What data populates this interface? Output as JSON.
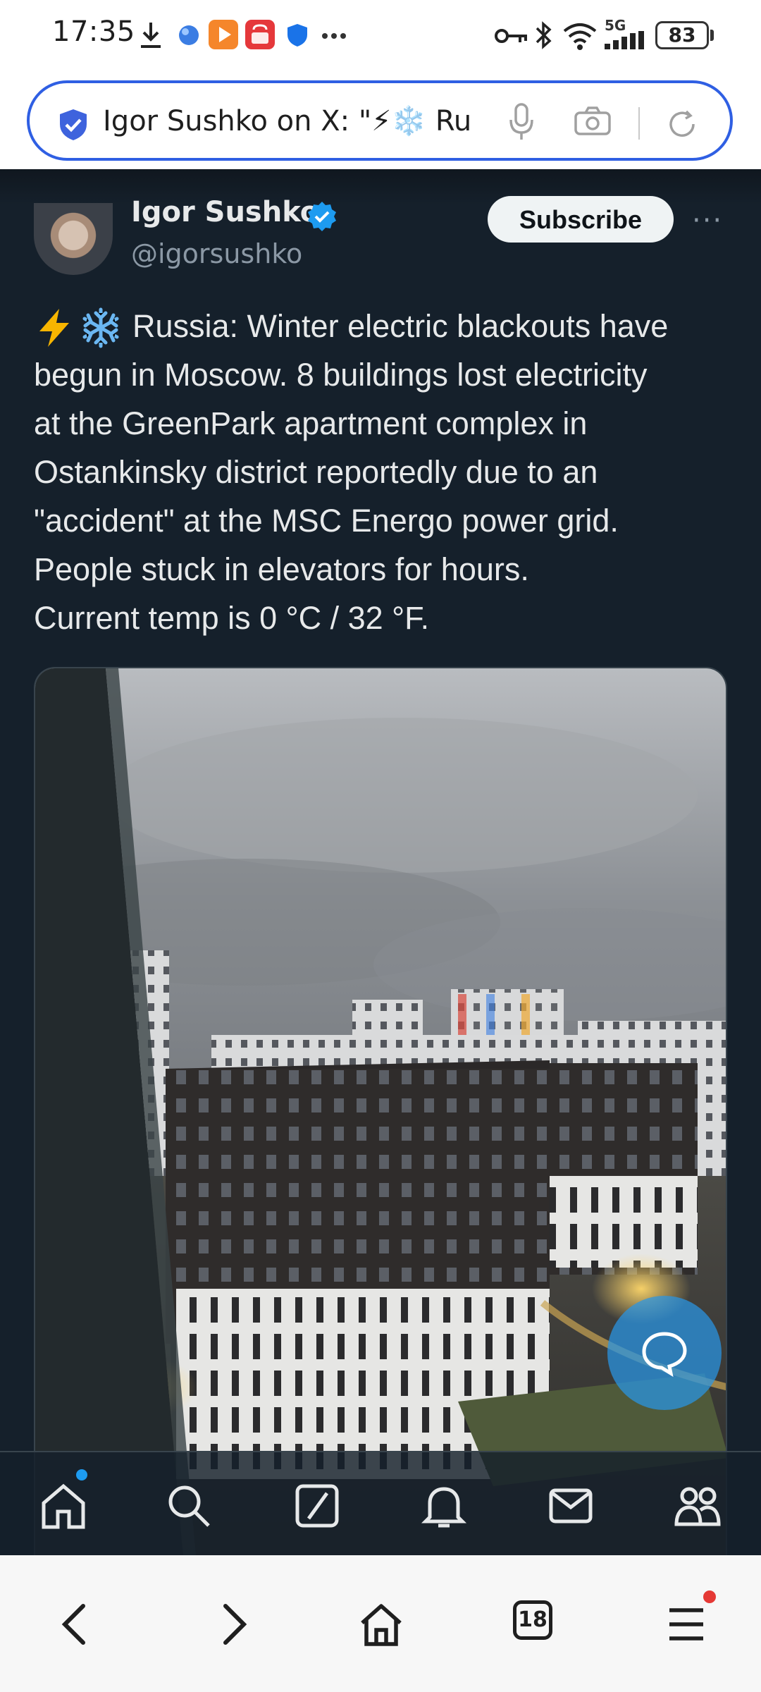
{
  "status_bar": {
    "time": "17:35",
    "network": "5G",
    "battery": "83"
  },
  "address_bar": {
    "url_text": "Igor Sushko on X: \"⚡❄️ Ru"
  },
  "tweet": {
    "author_name": "Igor Sushko",
    "handle": "@igorsushko",
    "subscribe_label": "Subscribe",
    "more_label": "···",
    "text": "Russia: Winter electric blackouts have\nbegun in Moscow. 8 buildings lost electricity\nat the GreenPark apartment complex in\nOstankinsky district reportedly due to an\n\"accident\" at the MSC Energo power grid.\nPeople stuck in elevators for hours.\nCurrent temp is 0 °C / 32 °F."
  },
  "x_nav": {
    "items": [
      "home-icon",
      "search-icon",
      "grok-icon",
      "notifications-icon",
      "messages-icon",
      "communities-icon"
    ]
  },
  "browser_bar": {
    "tabs_count": "18",
    "items": [
      "back-icon",
      "forward-icon",
      "home-icon",
      "tabs-icon",
      "menu-icon"
    ]
  },
  "colors": {
    "background": "#15202b",
    "accent": "#1d9bf0",
    "address_border": "#2f5fe3",
    "muted_text": "#8b98a5"
  }
}
